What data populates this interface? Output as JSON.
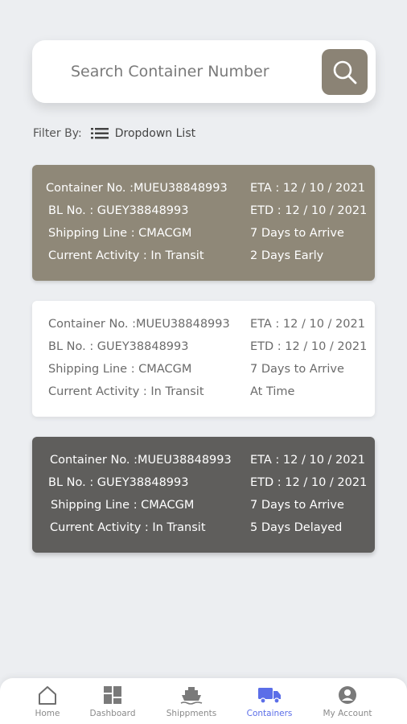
{
  "search": {
    "placeholder": "Search Container Number"
  },
  "filter": {
    "label": "Filter By:",
    "dropdown_label": "Dropdown List"
  },
  "containers": [
    {
      "container_no": "Container No. :MUEU38848993",
      "bl_no": "BL No. : GUEY38848993",
      "shipping_line": "Shipping Line : CMACGM",
      "current_activity": "Current Activity : In Transit",
      "eta": "ETA : 12 / 10 / 2021",
      "etd": "ETD : 12 / 10 / 2021",
      "days_to_arrive": "7 Days to Arrive",
      "status": "2 Days Early",
      "bg_color": "#8f8878"
    },
    {
      "container_no": "Container No. :MUEU38848993",
      "bl_no": "BL No. : GUEY38848993",
      "shipping_line": "Shipping Line : CMACGM",
      "current_activity": "Current Activity : In Transit",
      "eta": "ETA : 12 / 10 / 2021",
      "etd": "ETD : 12 / 10 / 2021",
      "days_to_arrive": "7 Days to Arrive",
      "status": "At Time",
      "bg_color": "#ffffff"
    },
    {
      "container_no": "Container No. :MUEU38848993",
      "bl_no": "BL No. : GUEY38848993",
      "shipping_line": "Shipping Line : CMACGM",
      "current_activity": "Current Activity : In Transit",
      "eta": "ETA : 12 / 10 / 2021",
      "etd": "ETD : 12 / 10 / 2021",
      "days_to_arrive": "7 Days to Arrive",
      "status": "5 Days Delayed",
      "bg_color": "#5f5e5c"
    }
  ],
  "nav": {
    "items": [
      {
        "label": "Home",
        "icon": "home-icon"
      },
      {
        "label": "Dashboard",
        "icon": "dashboard-icon"
      },
      {
        "label": "Shippments",
        "icon": "ship-icon"
      },
      {
        "label": "Containers",
        "icon": "truck-icon",
        "active": true
      },
      {
        "label": "My Account",
        "icon": "account-icon"
      }
    ]
  },
  "colors": {
    "accent": "#5b6ee8",
    "search_button": "#8b8375",
    "background": "#eceef1"
  }
}
